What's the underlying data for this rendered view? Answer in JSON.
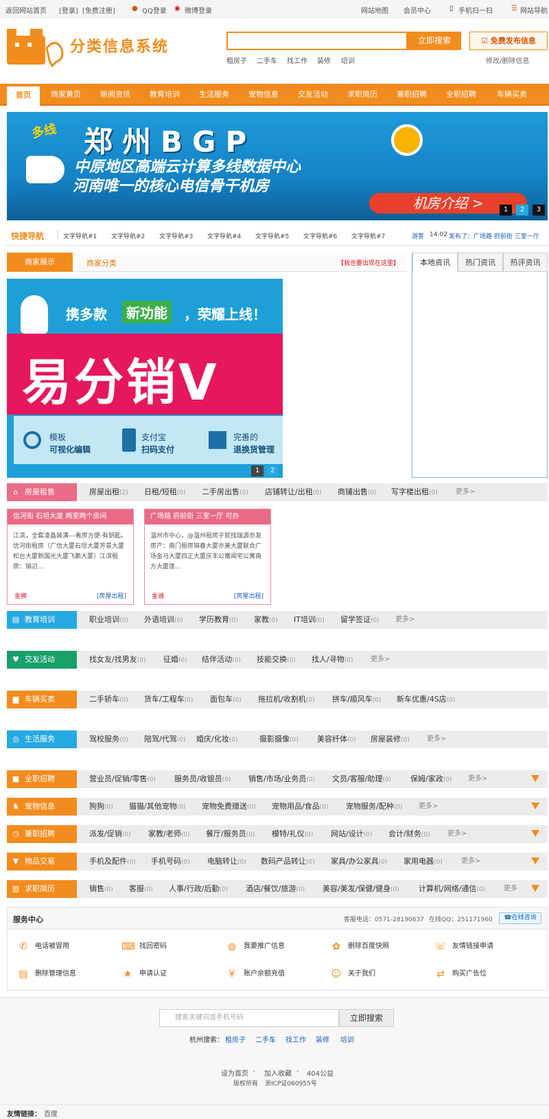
{
  "topbar": {
    "home": "返回网站首页",
    "login": "[登录]",
    "register": "[免费注册]",
    "qq_login": "QQ登录",
    "weibo_login": "微博登录",
    "sitemap": "网站地图",
    "member": "会员中心",
    "mobile": "手机扫一扫",
    "site_nav": "网站导航"
  },
  "header": {
    "logo_text": "分类信息系统",
    "search_placeholder": "",
    "search_btn": "立即搜索",
    "post_btn": "免费发布信息",
    "hotwords": [
      "租房子",
      "二手车",
      "找工作",
      "装修",
      "培训"
    ],
    "edit_link": "修改/删除信息"
  },
  "nav": [
    "首页",
    "商家黄页",
    "新闻资讯",
    "教育培训",
    "生活服务",
    "宠物信息",
    "交友活动",
    "求职简历",
    "兼职招聘",
    "全职招聘",
    "车辆买卖"
  ],
  "banner": {
    "tag": "多线",
    "title": "郑州BGP",
    "line1": "中原地区高端云计算多线数据中心",
    "line2": "河南唯一的核心电信骨干机房",
    "cta": "机房介绍 >",
    "pages": [
      "1",
      "2",
      "3"
    ]
  },
  "quicknav": {
    "title": "快捷导航",
    "items": [
      "文字导航#1",
      "文字导航#2",
      "文字导航#3",
      "文字导航#4",
      "文字导航#5",
      "文字导航#6",
      "文字导航#7"
    ],
    "ticker_user": "游客",
    "ticker_time": "14:02",
    "ticker_text": "发布了：广场路 府前街 三室一厅"
  },
  "merchant": {
    "tab_show": "商家展示",
    "tab_cat": "商家分类",
    "ad": "【我也要出现在这里】"
  },
  "promo": {
    "headline_a": "携多款",
    "headline_b": "新功能",
    "headline_c": "，荣耀上线！",
    "brand": "易分销V",
    "f1a": "模板",
    "f1b": "可视化编辑",
    "f2a": "支付宝",
    "f2b": "扫码支付",
    "f3a": "完善的",
    "f3b": "退换货管理",
    "pages": [
      "1",
      "2"
    ]
  },
  "news_tabs": [
    "本地资讯",
    "热门资讯",
    "热评资讯"
  ],
  "cats": {
    "housing": {
      "label": "房屋租售",
      "items": [
        [
          "房屋出租",
          "(2)"
        ],
        [
          "日租/短租",
          "(0)"
        ],
        [
          "二手房出售",
          "(0)"
        ],
        [
          "店铺转让/出租",
          "(0)"
        ],
        [
          "商铺出售",
          "(0)"
        ],
        [
          "写字楼出租",
          "(0)"
        ]
      ],
      "more": "更多>"
    },
    "edu": {
      "label": "教育培训",
      "items": [
        [
          "职业培训",
          "(0)"
        ],
        [
          "外语培训",
          "(0)"
        ],
        [
          "学历教育",
          "(0)"
        ],
        [
          "家教",
          "(0)"
        ],
        [
          "IT培训",
          "(0)"
        ],
        [
          "留学签证",
          "(0)"
        ]
      ],
      "more": "更多>"
    },
    "dating": {
      "label": "交友活动",
      "items": [
        [
          "找女友/找男友",
          "(0)"
        ],
        [
          "征婚",
          "(0)"
        ],
        [
          "结伴活动",
          "(0)"
        ],
        [
          "技能交换",
          "(0)"
        ],
        [
          "找人/寻物",
          "(0)"
        ]
      ],
      "more": "更多>"
    },
    "cars": {
      "label": "车辆买卖",
      "items": [
        [
          "二手轿车",
          "(0)"
        ],
        [
          "货车/工程车",
          "(0)"
        ],
        [
          "面包车",
          "(0)"
        ],
        [
          "拖拉机/收割机",
          "(0)"
        ],
        [
          "拼车/顺风车",
          "(0)"
        ],
        [
          "新车优惠/4S店",
          "(0)"
        ]
      ],
      "more": "更多>"
    },
    "life": {
      "label": "生活服务",
      "items": [
        [
          "驾校服务",
          "(0)"
        ],
        [
          "陪驾/代驾",
          "(0)"
        ],
        [
          "婚庆/化妆",
          "(0)"
        ],
        [
          "摄影摄像",
          "(0)"
        ],
        [
          "美容纤体",
          "(0)"
        ],
        [
          "房屋装修",
          "(0)"
        ]
      ],
      "more": "更多>"
    },
    "fulltime": {
      "label": "全职招聘",
      "items": [
        [
          "营业员/促销/零售",
          "(0)"
        ],
        [
          "服务员/收银员",
          "(0)"
        ],
        [
          "销售/市场/业务员",
          "(0)"
        ],
        [
          "文员/客服/助理",
          "(0)"
        ],
        [
          "保姆/家政",
          "(0)"
        ]
      ],
      "more": "更多>"
    },
    "pets": {
      "label": "宠物信息",
      "items": [
        [
          "狗狗",
          "(0)"
        ],
        [
          "猫猫/其他宠物",
          "(0)"
        ],
        [
          "宠物免费赠送",
          "(0)"
        ],
        [
          "宠物用品/食品",
          "(0)"
        ],
        [
          "宠物服务/配种",
          "(0)"
        ]
      ],
      "more": "更多>"
    },
    "parttime": {
      "label": "兼职招聘",
      "items": [
        [
          "派发/促销",
          "(0)"
        ],
        [
          "家教/老师",
          "(0)"
        ],
        [
          "餐厅/服务员",
          "(0)"
        ],
        [
          "模特/礼仪",
          "(0)"
        ],
        [
          "网站/设计",
          "(0)"
        ],
        [
          "会计/财务",
          "(0)"
        ]
      ],
      "more": "更多>"
    },
    "goods": {
      "label": "物品交易",
      "items": [
        [
          "手机及配件",
          "(0)"
        ],
        [
          "手机号码",
          "(0)"
        ],
        [
          "电脑转让",
          "(0)"
        ],
        [
          "数码产品转让",
          "(0)"
        ],
        [
          "家具/办公家具",
          "(0)"
        ],
        [
          "家用电器",
          "(0)"
        ]
      ],
      "more": "更多>"
    },
    "resume": {
      "label": "求职简历",
      "items": [
        [
          "销售",
          "(0)"
        ],
        [
          "客服",
          "(0)"
        ],
        [
          "人事/行政/后勤",
          "(0)"
        ],
        [
          "酒店/餐饮/旅游",
          "(0)"
        ],
        [
          "美容/美发/保健/健身",
          "(0)"
        ],
        [
          "计算机/网络/通信",
          "(0)"
        ]
      ],
      "more": "更多"
    }
  },
  "cards": [
    {
      "title": "信河街 石坦大厦 两室两个房间",
      "body": "江滨，全套凌晶装潢---看房方便-有钥匙。信河街租房（广信大厦石坦大厦芳景大厦松台大厦新国光大厦飞鹏大厦）江滨租房：锦辺...",
      "user": "金狮",
      "tag": "[房屋出租]"
    },
    {
      "title": "广场路 府前街 三室一厅 可办",
      "body": "温州市中心，@温州租房子就找瑞源亦发房产：南门租房锦春大厦亦美大厦联合广场金马大厦四正大厦庆丰公寓闻宅公寓南方大厦莲...",
      "user": "金诚",
      "tag": "[房屋出租]"
    }
  ],
  "service": {
    "title": "服务中心",
    "phone": "客服电话：0571-28190637",
    "qq": "在线QQ：251171960",
    "consult": "在线咨询",
    "items": [
      "电话被冒用",
      "找回密码",
      "我要推广信息",
      "删除百度快照",
      "友情链接申请",
      "删除管理信息",
      "申请认证",
      "账户余额充值",
      "关于我们",
      "购买广告位"
    ]
  },
  "footer": {
    "search_placeholder": "搜索关键词或手机号码",
    "search_btn": "立即搜索",
    "hot_label": "杭州搜索：",
    "hotwords": [
      "租房子",
      "二手车",
      "找工作",
      "装修",
      "培训"
    ],
    "links": [
      "设为首页",
      "-",
      "加入收藏",
      "-",
      "404公益"
    ],
    "rights": "版权所有",
    "icp": "浙ICP证060955号",
    "friend_label": "友情链接：",
    "friend_item": "百度"
  },
  "colors": {
    "accent": "#f28c1e",
    "pink": "#e96b86",
    "blue": "#1a5fb4",
    "teal": "#27a9e1",
    "green": "#1aa06b"
  }
}
